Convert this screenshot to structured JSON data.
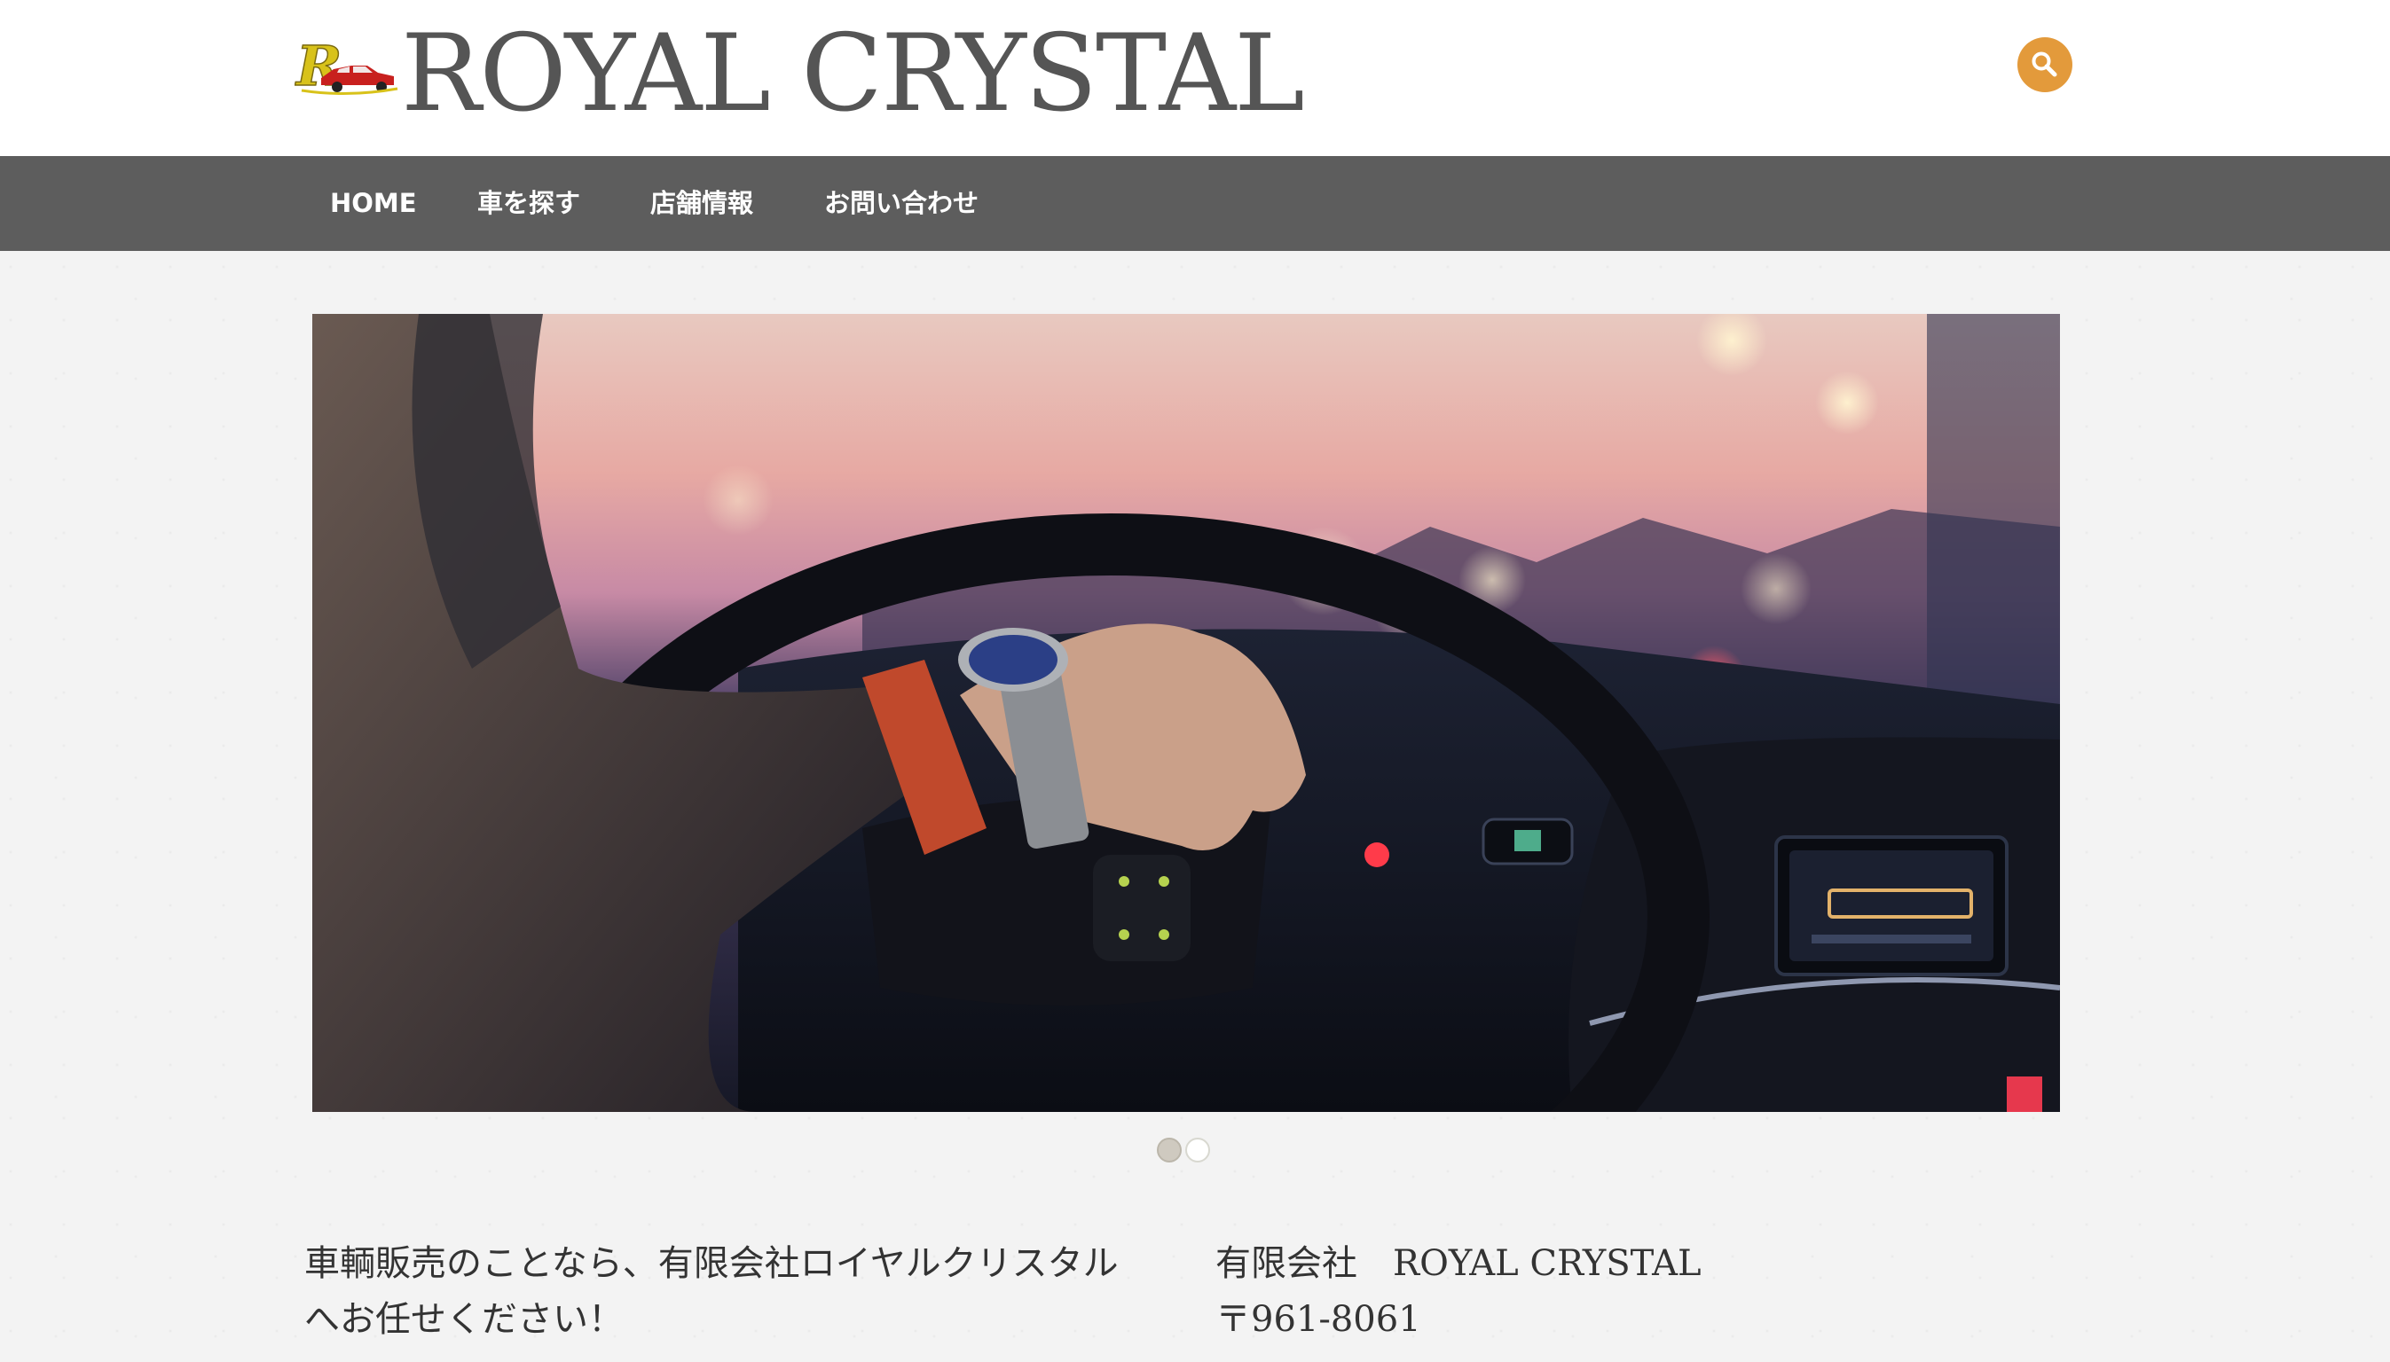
{
  "header": {
    "logo_alt": "R logo with red car",
    "site_title": "ROYAL CRYSTAL",
    "search_icon": "search-icon",
    "accent_color": "#e39a3b"
  },
  "nav": {
    "items": [
      {
        "label": "HOME"
      },
      {
        "label": "車を探す"
      },
      {
        "label": "店舗情報"
      },
      {
        "label": "お問い合わせ"
      }
    ],
    "background": "#5d5d5d"
  },
  "hero": {
    "image": "driver-hand-on-steering-wheel-with-wristwatch",
    "slides_total": 2,
    "active_slide": 1
  },
  "intro": {
    "text": "車輌販売のことなら、有限会社ロイヤルクリスタルへお任せください！"
  },
  "company": {
    "name": "有限会社　ROYAL CRYSTAL",
    "postal": "〒961-8061"
  }
}
